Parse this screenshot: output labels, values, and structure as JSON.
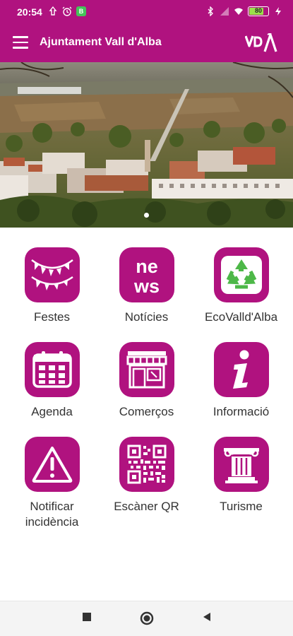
{
  "status_bar": {
    "time": "20:54",
    "left_icons": [
      "notification-icon",
      "alarm-icon",
      "app-badge-icon"
    ],
    "app_badge": "B",
    "right_icons": [
      "bluetooth-icon",
      "signal-icon",
      "wifi-icon",
      "battery-icon",
      "charging-icon"
    ],
    "battery_level": "80",
    "battery_fraction": 0.8
  },
  "app_bar": {
    "title": "Ajuntament Vall d'Alba",
    "logo_text": "VdA"
  },
  "carousel": {
    "slide_count": 1,
    "active_index": 0
  },
  "tiles": [
    {
      "label": "Festes",
      "icon": "festes-icon"
    },
    {
      "label": "Notícies",
      "icon": "news-icon"
    },
    {
      "label": "EcoValld'Alba",
      "icon": "recycle-icon"
    },
    {
      "label": "Agenda",
      "icon": "calendar-icon"
    },
    {
      "label": "Comerços",
      "icon": "shop-icon"
    },
    {
      "label": "Informació",
      "icon": "info-icon"
    },
    {
      "label": "Notificar incidència",
      "icon": "warning-icon"
    },
    {
      "label": "Escàner QR",
      "icon": "qr-code-icon"
    },
    {
      "label": "Turisme",
      "icon": "column-icon"
    }
  ],
  "colors": {
    "brand": "#b0127f",
    "recycle_green": "#4db848"
  },
  "nav_bar": [
    "recents-button",
    "home-button",
    "back-button"
  ]
}
